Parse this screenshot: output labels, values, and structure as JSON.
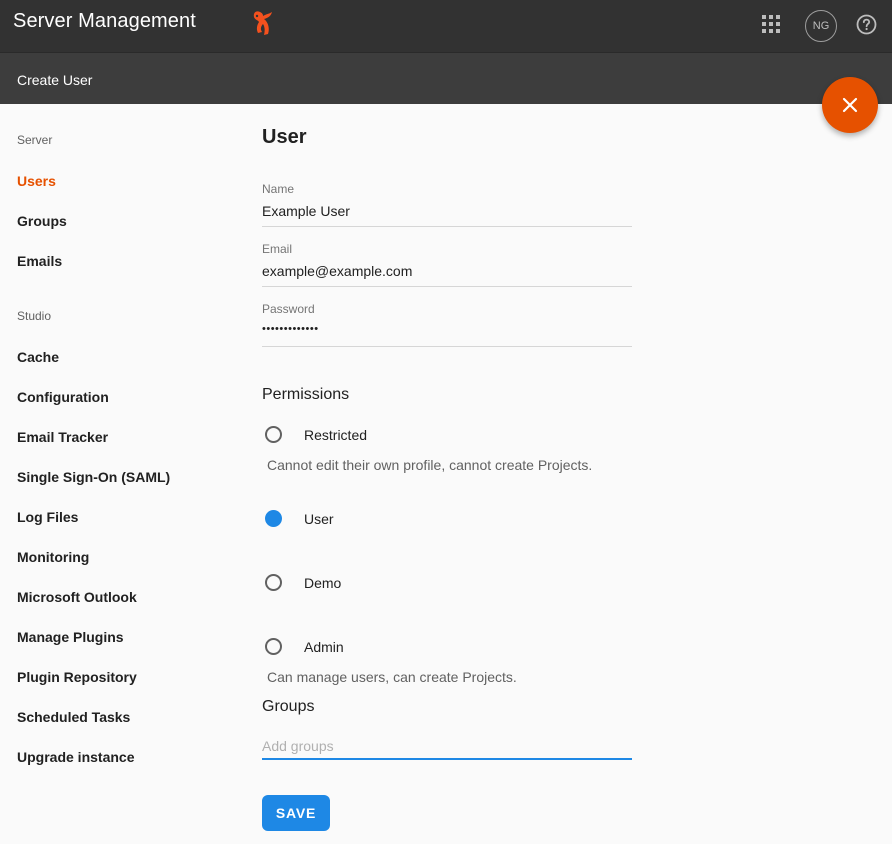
{
  "header": {
    "app_title": "Server Management",
    "logo_icon": "squirrel-logo",
    "apps_icon": "apps-grid-icon",
    "avatar_initials": "NG",
    "help_icon": "help-icon"
  },
  "subheader": {
    "title": "Create User"
  },
  "fab": {
    "icon": "close-icon",
    "color": "#e65100"
  },
  "sidebar": {
    "sections": [
      {
        "label": "Server",
        "items": [
          {
            "label": "Users",
            "active": true
          },
          {
            "label": "Groups",
            "active": false
          },
          {
            "label": "Emails",
            "active": false
          }
        ]
      },
      {
        "label": "Studio",
        "items": [
          {
            "label": "Cache"
          },
          {
            "label": "Configuration"
          },
          {
            "label": "Email Tracker"
          },
          {
            "label": "Single Sign-On (SAML)"
          },
          {
            "label": "Log Files"
          },
          {
            "label": "Monitoring"
          },
          {
            "label": "Microsoft Outlook"
          },
          {
            "label": "Manage Plugins"
          },
          {
            "label": "Plugin Repository"
          },
          {
            "label": "Scheduled Tasks"
          },
          {
            "label": "Upgrade instance"
          }
        ]
      }
    ]
  },
  "form": {
    "heading": "User",
    "name": {
      "label": "Name",
      "value": "Example User"
    },
    "email": {
      "label": "Email",
      "value": "example@example.com"
    },
    "password": {
      "label": "Password",
      "value": "•••••••••••••"
    },
    "permissions": {
      "title": "Permissions",
      "selected": "User",
      "options": [
        {
          "label": "Restricted",
          "description": "Cannot edit their own profile, cannot create Projects.",
          "checked": false
        },
        {
          "label": "User",
          "description": "",
          "checked": true
        },
        {
          "label": "Demo",
          "description": "",
          "checked": false
        },
        {
          "label": "Admin",
          "description": "Can manage users, can create Projects.",
          "checked": false
        }
      ]
    },
    "groups": {
      "title": "Groups",
      "placeholder": "Add groups",
      "value": ""
    },
    "save_label": "SAVE"
  },
  "colors": {
    "accent": "#e65100",
    "primary": "#1e88e5",
    "topbar": "#323232"
  }
}
